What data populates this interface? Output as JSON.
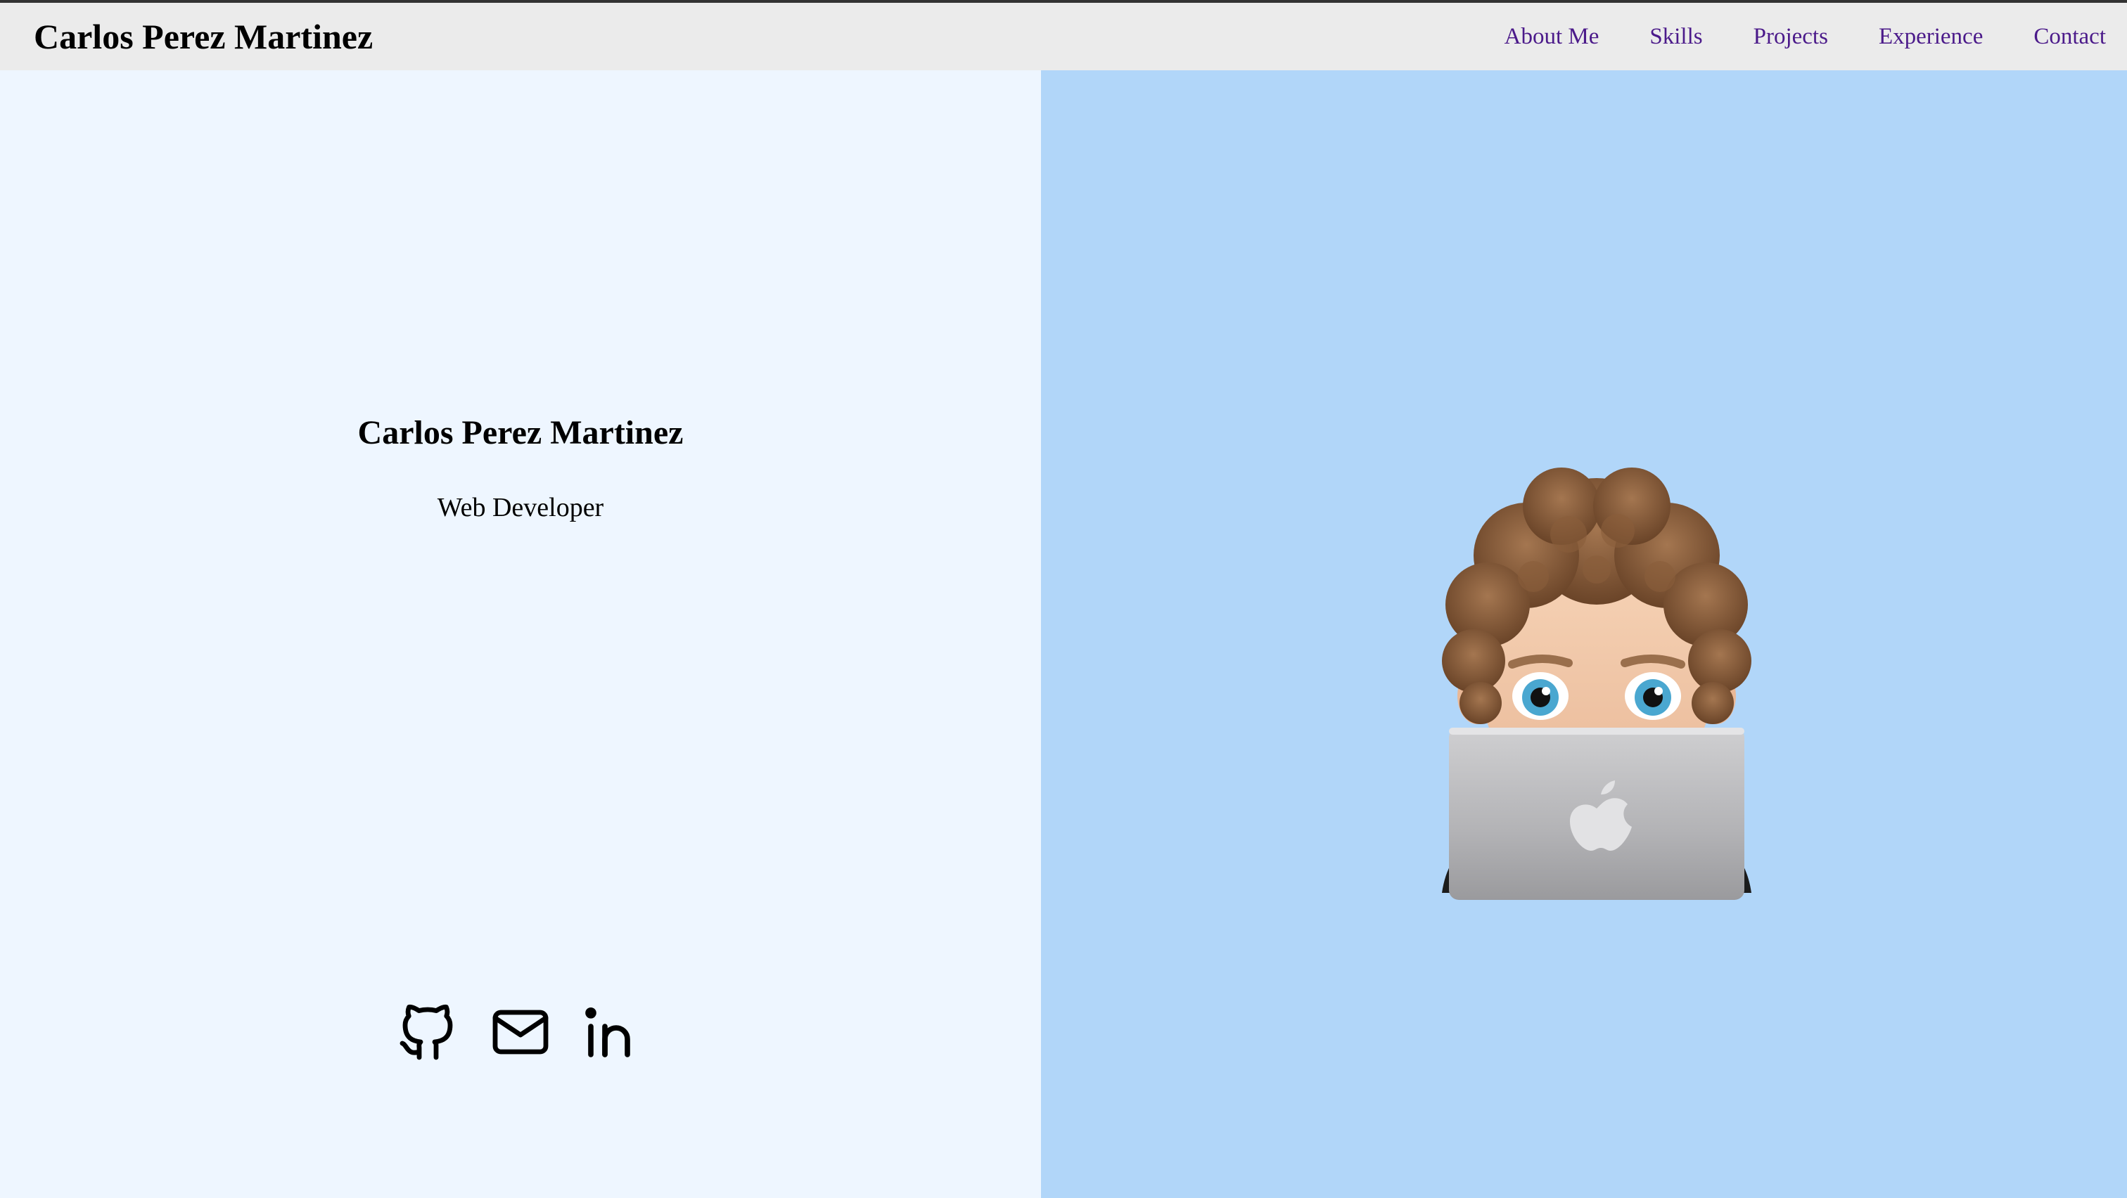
{
  "header": {
    "brand": "Carlos Perez Martinez",
    "nav": [
      "About Me",
      "Skills",
      "Projects",
      "Experience",
      "Contact"
    ]
  },
  "hero": {
    "name": "Carlos Perez Martinez",
    "role": "Web Developer"
  },
  "social": [
    {
      "icon": "github-icon"
    },
    {
      "icon": "mail-icon"
    },
    {
      "icon": "linkedin-icon"
    }
  ],
  "avatar": {
    "icon": "memoji-laptop-avatar"
  },
  "colors": {
    "nav_bg": "#ebebeb",
    "nav_link": "#4b1a8a",
    "left_bg": "#eef6ff",
    "right_bg": "#b1d6f9"
  }
}
